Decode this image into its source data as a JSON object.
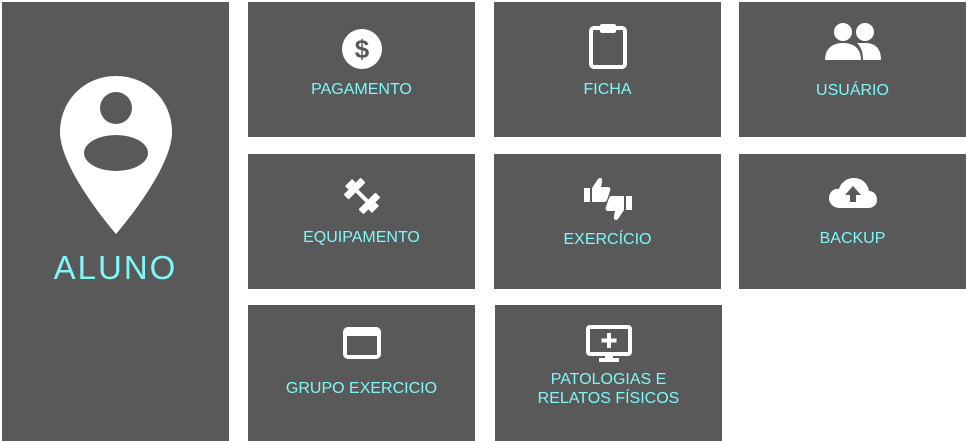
{
  "main_tile": {
    "label": "ALUNO",
    "icon": "user-location-pin-icon"
  },
  "tiles": [
    {
      "label": "PAGAMENTO",
      "icon": "dollar-coin-icon"
    },
    {
      "label": "FICHA",
      "icon": "clipboard-icon"
    },
    {
      "label": "USUÁRIO",
      "icon": "users-icon"
    },
    {
      "label": "EQUIPAMENTO",
      "icon": "dumbbell-icon"
    },
    {
      "label": "EXERCÍCIO",
      "icon": "thumbs-up-down-icon"
    },
    {
      "label": "BACKUP",
      "icon": "cloud-upload-icon"
    },
    {
      "label": "GRUPO EXERCICIO",
      "icon": "window-icon"
    },
    {
      "label_line1": "PATOLOGIAS E",
      "label_line2": "RELATOS FÍSICOS",
      "icon": "monitor-plus-icon"
    }
  ],
  "colors": {
    "tile_bg": "#595959",
    "label": "#7ff7f7",
    "icon": "#ffffff"
  }
}
